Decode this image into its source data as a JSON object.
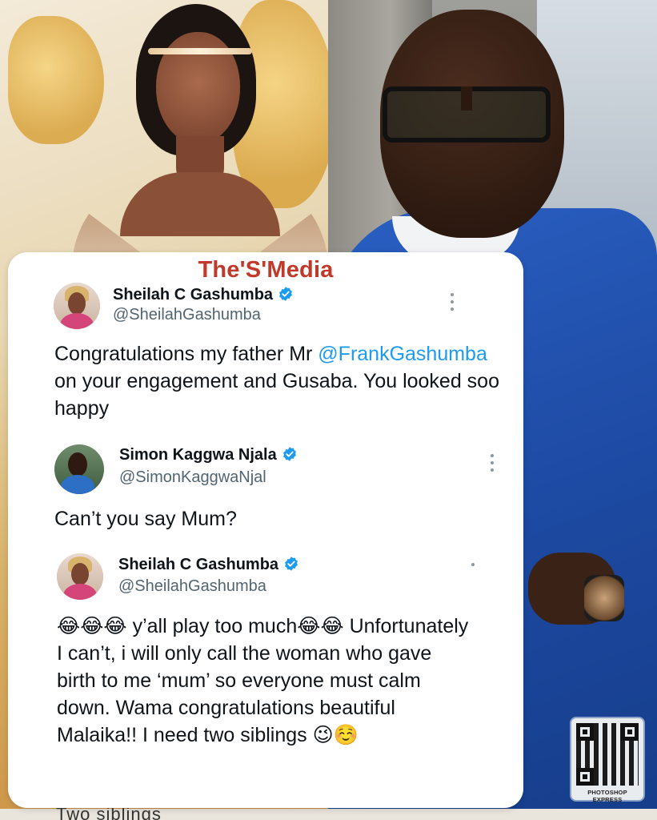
{
  "watermark": "The'S'Media",
  "tweets": [
    {
      "name": "Sheilah C Gashumba",
      "handle": "@SheilahGashumba",
      "verified": true,
      "text_parts": [
        "Congratulations my father Mr ",
        "@FrankGashumba",
        " on your engagement and Gusaba. You looked soo happy"
      ]
    },
    {
      "name": "Simon Kaggwa Njala",
      "handle": "@SimonKaggwaNjal",
      "verified": true,
      "text": "Can’t you say Mum?"
    },
    {
      "name": "Sheilah C Gashumba",
      "handle": "@SheilahGashumba",
      "verified": true,
      "text": "😂😂😂 y’all play too much😂😂 Unfortunately I can’t, i will only call the woman who gave birth to me ‘mum’ so everyone must calm down. Wama congratulations beautiful Malaika!! I need two siblings 😉☺️"
    }
  ],
  "qr_badge": {
    "label": "PHOTOSHOP EXPRESS"
  },
  "bottom_strip_text": "Two siblings",
  "icons": {
    "verified": "verified-badge-icon",
    "more": "more-options-icon",
    "qr": "qr-code-icon"
  },
  "colors": {
    "watermark": "#c0392b",
    "mention": "#1d9bf0",
    "verified": "#1d9bf0",
    "handle": "#536471"
  }
}
